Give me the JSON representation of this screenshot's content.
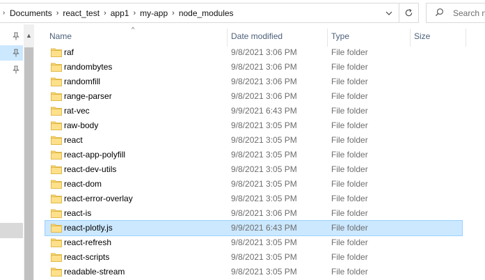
{
  "address": {
    "crumbs": [
      "Documents",
      "react_test",
      "app1",
      "my-app",
      "node_modules"
    ],
    "search_placeholder": "Search n"
  },
  "columns": {
    "name": "Name",
    "date_modified": "Date modified",
    "type": "Type",
    "size": "Size"
  },
  "rows": [
    {
      "name": "raf",
      "date": "9/8/2021 3:06 PM",
      "type": "File folder"
    },
    {
      "name": "randombytes",
      "date": "9/8/2021 3:06 PM",
      "type": "File folder"
    },
    {
      "name": "randomfill",
      "date": "9/8/2021 3:06 PM",
      "type": "File folder"
    },
    {
      "name": "range-parser",
      "date": "9/8/2021 3:06 PM",
      "type": "File folder"
    },
    {
      "name": "rat-vec",
      "date": "9/9/2021 6:43 PM",
      "type": "File folder"
    },
    {
      "name": "raw-body",
      "date": "9/8/2021 3:05 PM",
      "type": "File folder"
    },
    {
      "name": "react",
      "date": "9/8/2021 3:05 PM",
      "type": "File folder"
    },
    {
      "name": "react-app-polyfill",
      "date": "9/8/2021 3:05 PM",
      "type": "File folder"
    },
    {
      "name": "react-dev-utils",
      "date": "9/8/2021 3:05 PM",
      "type": "File folder"
    },
    {
      "name": "react-dom",
      "date": "9/8/2021 3:05 PM",
      "type": "File folder"
    },
    {
      "name": "react-error-overlay",
      "date": "9/8/2021 3:05 PM",
      "type": "File folder"
    },
    {
      "name": "react-is",
      "date": "9/8/2021 3:06 PM",
      "type": "File folder"
    },
    {
      "name": "react-plotly.js",
      "date": "9/9/2021 6:43 PM",
      "type": "File folder",
      "selected": true
    },
    {
      "name": "react-refresh",
      "date": "9/8/2021 3:05 PM",
      "type": "File folder"
    },
    {
      "name": "react-scripts",
      "date": "9/8/2021 3:05 PM",
      "type": "File folder"
    },
    {
      "name": "readable-stream",
      "date": "9/8/2021 3:05 PM",
      "type": "File folder"
    }
  ],
  "icons": {
    "folder": "folder-icon",
    "pin": "pin-icon",
    "refresh": "refresh-icon",
    "search": "search-icon"
  },
  "colors": {
    "selection": "#cce8ff",
    "folder": "#f8d775",
    "header_text": "#4c607a"
  }
}
